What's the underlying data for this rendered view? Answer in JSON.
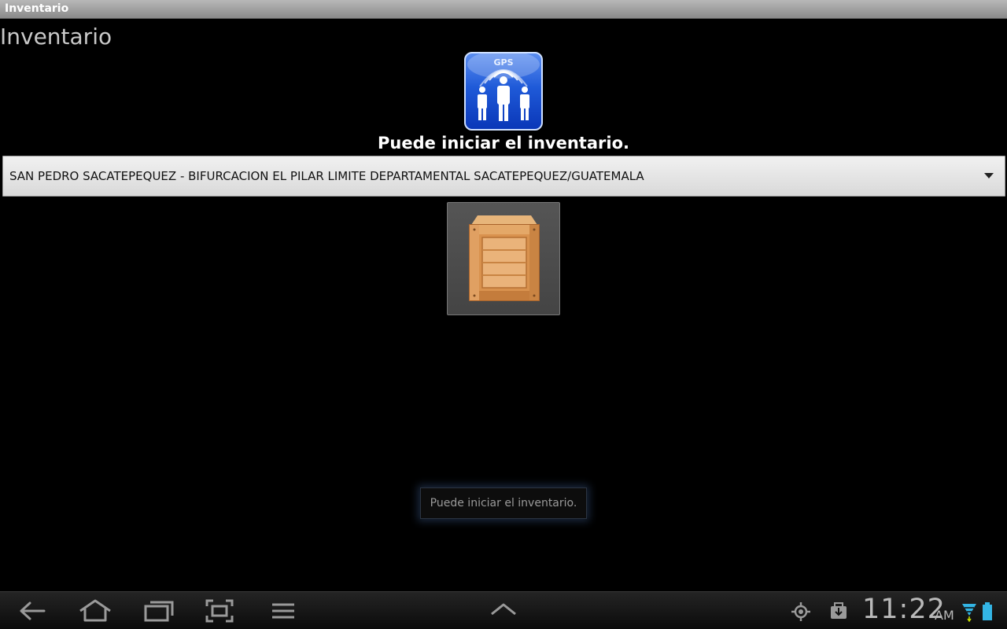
{
  "window": {
    "title": "Inventario"
  },
  "app": {
    "title": "Inventario"
  },
  "status": {
    "message": "Puede iniciar el inventario."
  },
  "location_spinner": {
    "selected": "SAN PEDRO SACATEPEQUEZ - BIFURCACION EL PILAR LIMITE DEPARTAMENTAL SACATEPEQUEZ/GUATEMALA"
  },
  "logo": {
    "label": "GPS"
  },
  "toast": {
    "message": "Puede iniciar el inventario."
  },
  "system_bar": {
    "time": "11:22",
    "ampm": "AM",
    "icons": [
      "back-icon",
      "home-icon",
      "recent-apps-icon",
      "screenshot-icon",
      "menu-icon",
      "up-chevron-icon",
      "gps-icon",
      "download-icon",
      "wifi-icon",
      "battery-icon"
    ]
  },
  "colors": {
    "background": "#000000",
    "logo_blue": "#1f5ad8",
    "spinner_bg": "#e6e6e6",
    "nav_icon": "#9a9a9a",
    "wifi_blue": "#33b5e5"
  }
}
